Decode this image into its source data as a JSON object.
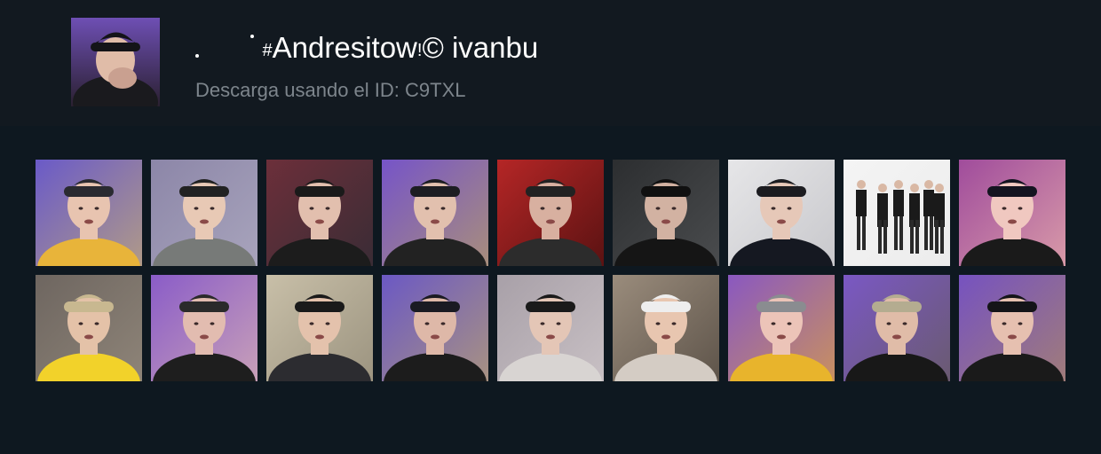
{
  "profile": {
    "title_prefix": "#",
    "title_main": "Andresitow",
    "title_mark": "!",
    "title_symbol": "©",
    "title_tail": "ivanbu",
    "subtitle": "Descarga usando el ID: C9TXL"
  },
  "videos": [
    {
      "icon": "person-portrait",
      "bg": "#6a5ac8",
      "hair": "#2a2a30",
      "shirt": "#e8b43a",
      "face": "#e8c4b0",
      "bg2": "#b09a88"
    },
    {
      "icon": "person-portrait",
      "bg": "#8c86a8",
      "hair": "#222",
      "shirt": "#777a78",
      "face": "#e8c9b5",
      "bg2": "#a8a4bc"
    },
    {
      "icon": "person-portrait",
      "bg": "#6c2f3a",
      "hair": "#1a1a1a",
      "shirt": "#1c1c1c",
      "face": "#e2bfae",
      "bg2": "#3a2c35"
    },
    {
      "icon": "person-portrait",
      "bg": "#7654c8",
      "hair": "#1d1d22",
      "shirt": "#222",
      "face": "#e2c0ae",
      "bg2": "#a88e7c"
    },
    {
      "icon": "person-portrait",
      "bg": "#b52626",
      "hair": "#222",
      "shirt": "#2c2c2c",
      "face": "#d8b0a0",
      "bg2": "#5a1212"
    },
    {
      "icon": "person-portrait",
      "bg": "#2c2e30",
      "hair": "#101010",
      "shirt": "#151515",
      "face": "#d2b2a2",
      "bg2": "#4a4c4e"
    },
    {
      "icon": "person-portrait",
      "bg": "#e6e6e8",
      "hair": "#1c1c20",
      "shirt": "#151821",
      "face": "#e6c8b8",
      "bg2": "#c8c8cc"
    },
    {
      "icon": "group-dancers",
      "bg": "#f4f4f4",
      "hair": "#222",
      "shirt": "#1a1a1a",
      "face": "#d9b8a4",
      "bg2": "#ececec"
    },
    {
      "icon": "person-portrait",
      "bg": "#a04c9c",
      "hair": "#141420",
      "shirt": "#1a1a1a",
      "face": "#f0c8c0",
      "bg2": "#d89aa8"
    },
    {
      "icon": "person-portrait",
      "bg": "#6e6660",
      "hair": "#c8b890",
      "shirt": "#f2d22a",
      "face": "#e4c2a8",
      "bg2": "#8e8478"
    },
    {
      "icon": "person-portrait",
      "bg": "#8a5cc8",
      "hair": "#2a2a2a",
      "shirt": "#1e1e1e",
      "face": "#e2bcb0",
      "bg2": "#c8a0b8"
    },
    {
      "icon": "person-portrait",
      "bg": "#c8bfa8",
      "hair": "#1a1a1a",
      "shirt": "#2c2c30",
      "face": "#e4c2ac",
      "bg2": "#9c9480"
    },
    {
      "icon": "person-portrait",
      "bg": "#6b58c4",
      "hair": "#1a1a22",
      "shirt": "#1c1c1c",
      "face": "#deb8a8",
      "bg2": "#a89282"
    },
    {
      "icon": "person-portrait",
      "bg": "#a8a0a8",
      "hair": "#1a1a1a",
      "shirt": "#d8d4d2",
      "face": "#e4c6b6",
      "bg2": "#c8c0c4"
    },
    {
      "icon": "person-portrait",
      "bg": "#9a8c7c",
      "hair": "#eeeeee",
      "shirt": "#d4ccc4",
      "face": "#e8c6b0",
      "bg2": "#5e544a"
    },
    {
      "icon": "person-portrait",
      "bg": "#8a58c0",
      "hair": "#8a8c90",
      "shirt": "#e8b42c",
      "face": "#ecc4b8",
      "bg2": "#c89060"
    },
    {
      "icon": "person-portrait",
      "bg": "#7a58c4",
      "hair": "#b4ac90",
      "shirt": "#181818",
      "face": "#e0bca8",
      "bg2": "#6a5a70"
    },
    {
      "icon": "person-portrait",
      "bg": "#7652c0",
      "hair": "#141418",
      "shirt": "#1a1a1a",
      "face": "#e6c0b0",
      "bg2": "#a07c7a"
    }
  ]
}
